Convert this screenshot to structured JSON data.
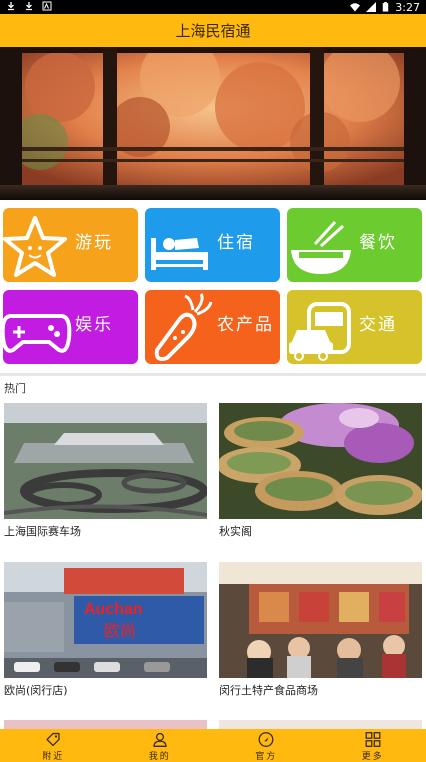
{
  "status_bar": {
    "time": "3:27",
    "left_icons": [
      "download-icon",
      "download-icon",
      "image-notification-icon"
    ],
    "right_icons": [
      "wifi-icon",
      "signal-icon",
      "battery-icon"
    ]
  },
  "header": {
    "title": "上海民宿通"
  },
  "banner": {
    "image": "autumn-garden-window-view"
  },
  "categories": [
    {
      "label": "游玩",
      "color": "#F7A21B",
      "icon": "star-icon"
    },
    {
      "label": "住宿",
      "color": "#1E9BEA",
      "icon": "bed-icon"
    },
    {
      "label": "餐饮",
      "color": "#6CCB2E",
      "icon": "bowl-icon"
    },
    {
      "label": "娱乐",
      "color": "#C21BE2",
      "icon": "gamepad-icon"
    },
    {
      "label": "农产品",
      "color": "#F4621B",
      "icon": "carrot-icon"
    },
    {
      "label": "交通",
      "color": "#D6C22A",
      "icon": "car-icon"
    }
  ],
  "hot_section": {
    "title": "热门"
  },
  "hot_items": [
    {
      "name": "上海国际赛车场",
      "image": "race-circuit-aerial"
    },
    {
      "name": "秋实阁",
      "image": "sesame-pastry-with-orchids"
    },
    {
      "name": "欧尚(闵行店)",
      "image": "auchan-store-front"
    },
    {
      "name": "闵行土特产食品商场",
      "image": "food-shop-crowd"
    }
  ],
  "bottom_nav": [
    {
      "label": "附近",
      "icon": "tag-icon"
    },
    {
      "label": "我的",
      "icon": "user-icon"
    },
    {
      "label": "官方",
      "icon": "compass-icon"
    },
    {
      "label": "更多",
      "icon": "grid-icon"
    }
  ],
  "colors": {
    "accent": "#FFB90F"
  }
}
